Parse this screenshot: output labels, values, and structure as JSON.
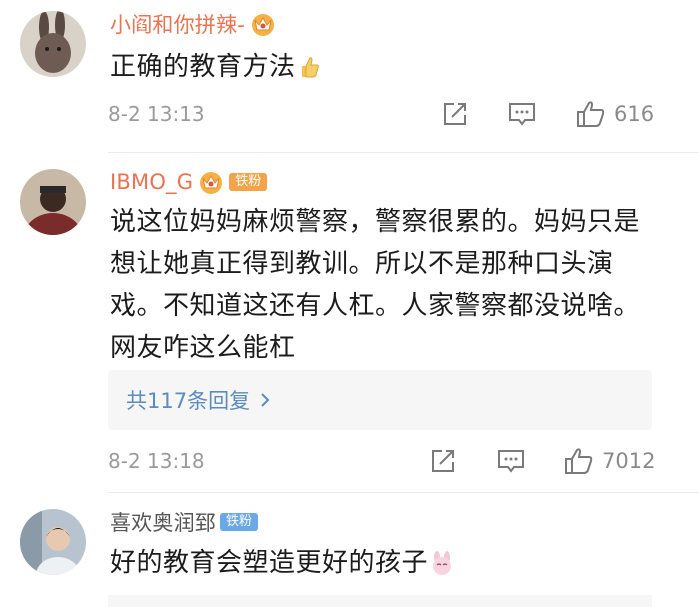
{
  "comments": [
    {
      "username": "小阎和你拼辣-",
      "badge": "",
      "text": "正确的教育方法",
      "emoji": "thumbs-up",
      "timestamp": "8-2 13:13",
      "likes": "616"
    },
    {
      "username": "IBMO_G",
      "badge": "铁粉",
      "text": "说这位妈妈麻烦警察，警察很累的。妈妈只是想让她真正得到教训。所以不是那种口头演戏。不知道这还有人杠。人家警察都没说啥。网友咋这么能杠",
      "reply_label": "共117条回复",
      "timestamp": "8-2 13:18",
      "likes": "7012"
    },
    {
      "username": "喜欢奥润郅",
      "badge": "铁粉",
      "text": "好的教育会塑造更好的孩子",
      "emoji": "bunny-face"
    }
  ],
  "colors": {
    "username": "#eb7350",
    "link": "#5b8bbf",
    "meta": "#9a9a9a",
    "badge_orange": "#f3a34a",
    "badge_blue": "#6aa9e6"
  }
}
